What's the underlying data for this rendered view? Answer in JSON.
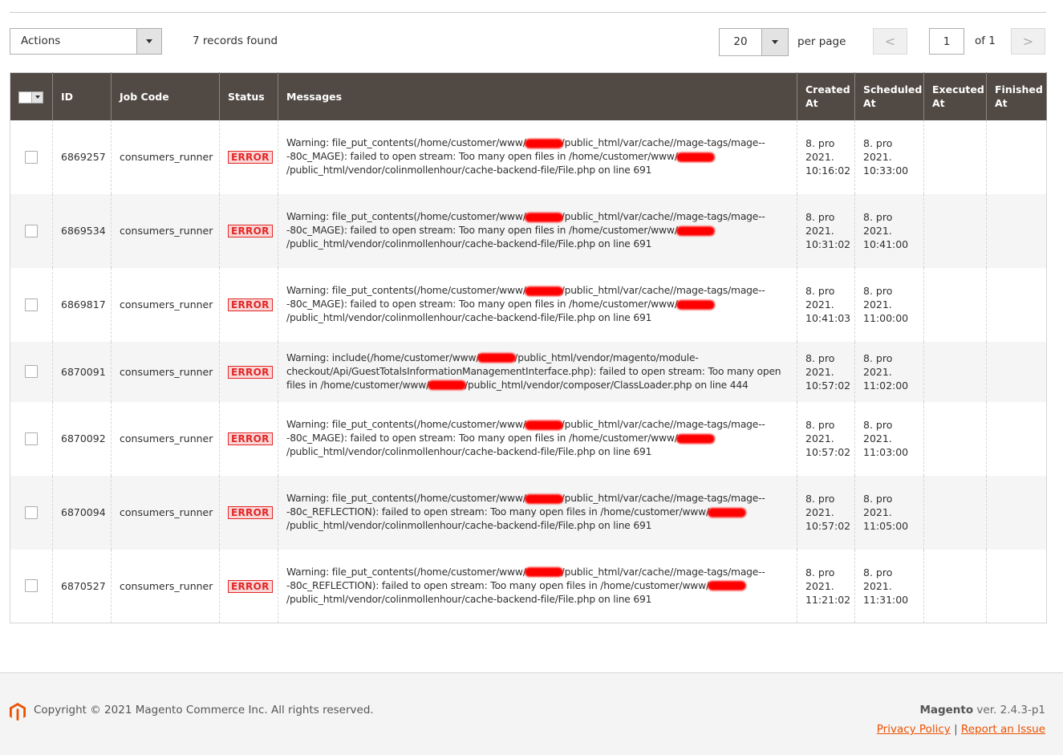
{
  "toolbar": {
    "actions_label": "Actions",
    "records_found": "7 records found",
    "per_page_value": "20",
    "per_page_label": "per page",
    "prev_icon": "<",
    "next_icon": ">",
    "current_page": "1",
    "total_pages_label": "of 1"
  },
  "table": {
    "columns": [
      "ID",
      "Job Code",
      "Status",
      "Messages",
      "Created At",
      "Scheduled At",
      "Executed At",
      "Finished At"
    ],
    "rows": [
      {
        "id": "6869257",
        "job_code": "consumers_runner",
        "status": "ERROR",
        "message_parts": [
          "Warning: file_put_contents(/home/customer/www/",
          "/public_html/var/cache//mage-tags/mage---80c_MAGE): failed to open stream: Too many open files in /home/customer/www/",
          "/public_html/vendor/colinmollenhour/cache-backend-file/File.php on line 691"
        ],
        "created_at": [
          "8. pro",
          "2021.",
          "10:16:02"
        ],
        "scheduled_at": [
          "8. pro",
          "2021.",
          "10:33:00"
        ],
        "executed_at": "",
        "finished_at": ""
      },
      {
        "id": "6869534",
        "job_code": "consumers_runner",
        "status": "ERROR",
        "message_parts": [
          "Warning: file_put_contents(/home/customer/www/",
          "/public_html/var/cache//mage-tags/mage---80c_MAGE): failed to open stream: Too many open files in /home/customer/www/",
          "/public_html/vendor/colinmollenhour/cache-backend-file/File.php on line 691"
        ],
        "created_at": [
          "8. pro",
          "2021.",
          "10:31:02"
        ],
        "scheduled_at": [
          "8. pro",
          "2021.",
          "10:41:00"
        ],
        "executed_at": "",
        "finished_at": ""
      },
      {
        "id": "6869817",
        "job_code": "consumers_runner",
        "status": "ERROR",
        "message_parts": [
          "Warning: file_put_contents(/home/customer/www/",
          "/public_html/var/cache//mage-tags/mage---80c_MAGE): failed to open stream: Too many open files in /home/customer/www/",
          "/public_html/vendor/colinmollenhour/cache-backend-file/File.php on line 691"
        ],
        "created_at": [
          "8. pro",
          "2021.",
          "10:41:03"
        ],
        "scheduled_at": [
          "8. pro",
          "2021.",
          "11:00:00"
        ],
        "executed_at": "",
        "finished_at": ""
      },
      {
        "id": "6870091",
        "job_code": "consumers_runner",
        "status": "ERROR",
        "message_parts": [
          "Warning: include(/home/customer/www/",
          "/public_html/vendor/magento/module-checkout/Api/GuestTotalsInformationManagementInterface.php): failed to open stream: Too many open files in /home/customer/www/",
          "/public_html/vendor/composer/ClassLoader.php on line 444"
        ],
        "created_at": [
          "8. pro",
          "2021.",
          "10:57:02"
        ],
        "scheduled_at": [
          "8. pro",
          "2021.",
          "11:02:00"
        ],
        "executed_at": "",
        "finished_at": ""
      },
      {
        "id": "6870092",
        "job_code": "consumers_runner",
        "status": "ERROR",
        "message_parts": [
          "Warning: file_put_contents(/home/customer/www/",
          "/public_html/var/cache//mage-tags/mage---80c_MAGE): failed to open stream: Too many open files in /home/customer/www/",
          "/public_html/vendor/colinmollenhour/cache-backend-file/File.php on line 691"
        ],
        "created_at": [
          "8. pro",
          "2021.",
          "10:57:02"
        ],
        "scheduled_at": [
          "8. pro",
          "2021.",
          "11:03:00"
        ],
        "executed_at": "",
        "finished_at": ""
      },
      {
        "id": "6870094",
        "job_code": "consumers_runner",
        "status": "ERROR",
        "message_parts": [
          "Warning: file_put_contents(/home/customer/www/",
          "/public_html/var/cache//mage-tags/mage---80c_REFLECTION): failed to open stream: Too many open files in /home/customer/www/",
          "/public_html/vendor/colinmollenhour/cache-backend-file/File.php on line 691"
        ],
        "created_at": [
          "8. pro",
          "2021.",
          "10:57:02"
        ],
        "scheduled_at": [
          "8. pro",
          "2021.",
          "11:05:00"
        ],
        "executed_at": "",
        "finished_at": ""
      },
      {
        "id": "6870527",
        "job_code": "consumers_runner",
        "status": "ERROR",
        "message_parts": [
          "Warning: file_put_contents(/home/customer/www/",
          "/public_html/var/cache//mage-tags/mage---80c_REFLECTION): failed to open stream: Too many open files in /home/customer/www/",
          "/public_html/vendor/colinmollenhour/cache-backend-file/File.php on line 691"
        ],
        "created_at": [
          "8. pro",
          "2021.",
          "11:21:02"
        ],
        "scheduled_at": [
          "8. pro",
          "2021.",
          "11:31:00"
        ],
        "executed_at": "",
        "finished_at": ""
      }
    ]
  },
  "footer": {
    "copyright": "Copyright © 2021 Magento Commerce Inc. All rights reserved.",
    "brand": "Magento",
    "version": " ver. 2.4.3-p1",
    "privacy_link": "Privacy Policy",
    "separator": "|",
    "report_link": "Report an Issue"
  },
  "colors": {
    "header_bg": "#514943",
    "error": "#e22626",
    "link": "#eb5202"
  }
}
